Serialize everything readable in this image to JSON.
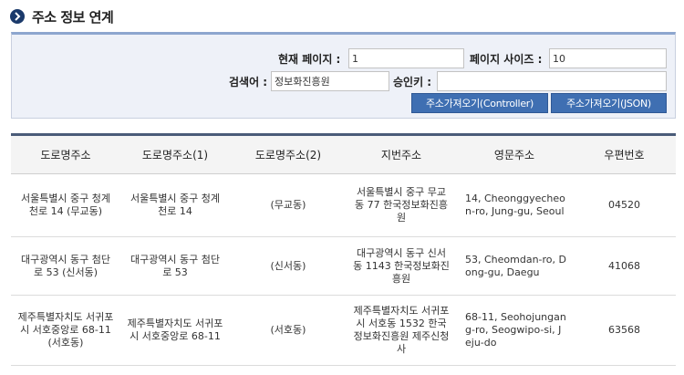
{
  "header": {
    "title": "주소 정보 연계"
  },
  "search": {
    "page_label": "현재 페이지 :",
    "page_value": "1",
    "size_label": "페이지 사이즈 :",
    "size_value": "10",
    "keyword_label": "검색어 :",
    "keyword_value": "정보화진흥원",
    "key_label": "승인키 :",
    "key_value": "",
    "btn_controller": "주소가져오기(Controller)",
    "btn_json": "주소가져오기(JSON)"
  },
  "table": {
    "headers": [
      "도로명주소",
      "도로명주소(1)",
      "도로명주소(2)",
      "지번주소",
      "영문주소",
      "우편번호"
    ],
    "rows": [
      [
        "서울특별시 중구 청계천로 14 (무교동)",
        "서울특별시 중구 청계천로 14",
        "(무교동)",
        "서울특별시 중구 무교동 77 한국정보화진흥원",
        "14, Cheonggyecheon-ro, Jung-gu, Seoul",
        "04520"
      ],
      [
        "대구광역시 동구 첨단로 53 (신서동)",
        "대구광역시 동구 첨단로 53",
        "(신서동)",
        "대구광역시 동구 신서동 1143 한국정보화진흥원",
        "53, Cheomdan-ro, Dong-gu, Daegu",
        "41068"
      ],
      [
        "제주특별자치도 서귀포시 서호중앙로 68-11 (서호동)",
        "제주특별자치도 서귀포시 서호중앙로 68-11",
        "(서호동)",
        "제주특별자치도 서귀포시 서호동 1532 한국정보화진흥원 제주신청사",
        "68-11, Seohojungang-ro, Seogwipo-si, Jeju-do",
        "63568"
      ]
    ]
  }
}
